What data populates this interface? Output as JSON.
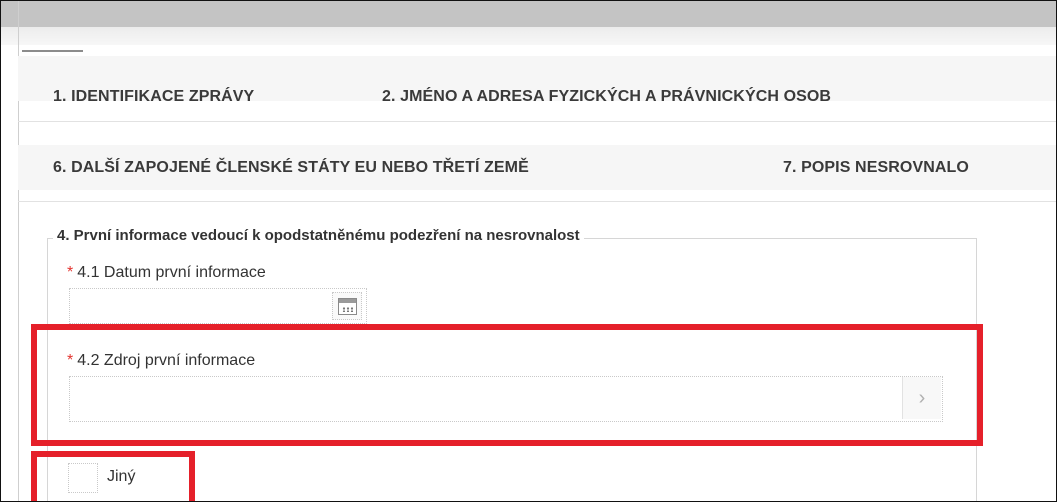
{
  "tabs": {
    "row1": [
      "1. IDENTIFIKACE ZPRÁVY",
      "2. JMÉNO A ADRESA FYZICKÝCH A PRÁVNICKÝCH OSOB"
    ],
    "row2": [
      "6. DALŠÍ ZAPOJENÉ ČLENSKÉ STÁTY EU NEBO TŘETÍ ZEMĚ",
      "7. POPIS NESROVNALO"
    ]
  },
  "section": {
    "title": "4. První informace vedoucí k opodstatněnému podezření na nesrovnalost",
    "required_mark": "*",
    "date_field": {
      "label": "4.1 Datum první informace",
      "value": ""
    },
    "source_field": {
      "label": "4.2 Zdroj první informace",
      "value": "",
      "button_glyph": "›"
    },
    "other_checkbox": {
      "label": "Jiný",
      "checked": false
    }
  },
  "colors": {
    "highlight": "#e5202a",
    "required": "#e3342f"
  },
  "icons": {
    "calendar": "calendar-icon",
    "chevron": "chevron-right-icon"
  }
}
